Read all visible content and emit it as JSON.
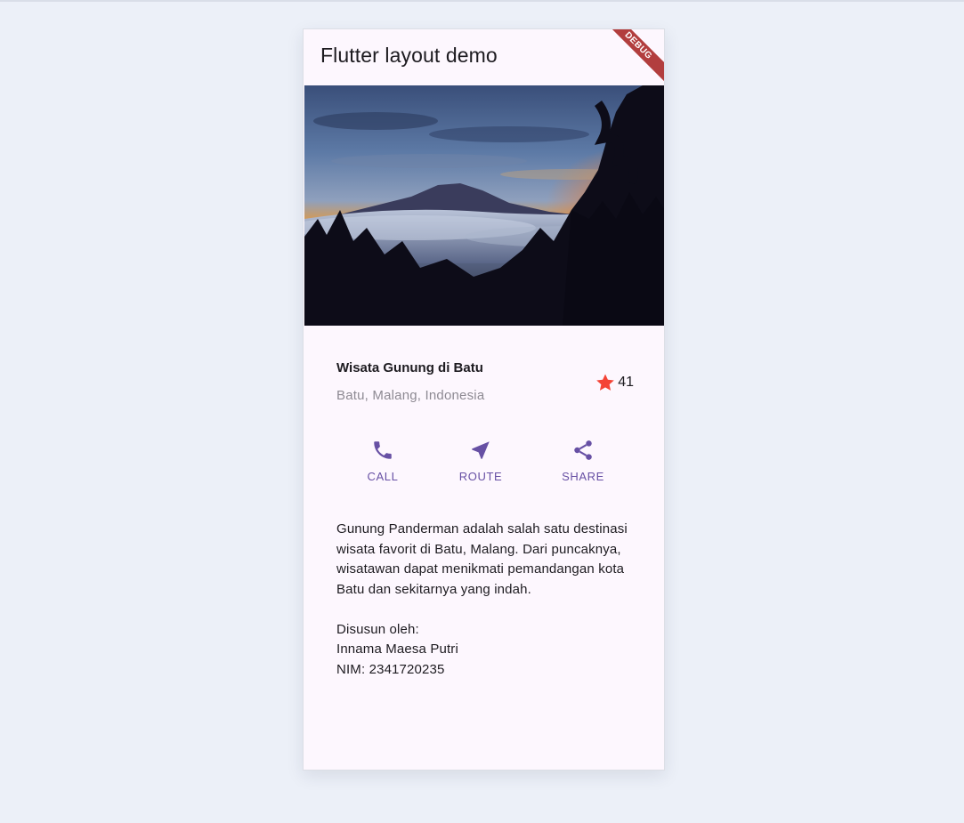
{
  "appbar": {
    "title": "Flutter layout demo",
    "debug_banner": "DEBUG"
  },
  "place": {
    "name": "Wisata Gunung di Batu",
    "location": "Batu, Malang, Indonesia",
    "rating_count": "41"
  },
  "actions": [
    {
      "label": "CALL",
      "icon": "phone-icon"
    },
    {
      "label": "ROUTE",
      "icon": "near-me-icon"
    },
    {
      "label": "SHARE",
      "icon": "share-icon"
    }
  ],
  "description": "Gunung Panderman adalah salah satu destinasi wisata favorit di Batu, Malang. Dari puncaknya, wisatawan dapat menikmati pemandangan kota Batu dan sekitarnya yang indah.\n\nDisusun oleh:\nInnama Maesa Putri\nNIM: 2341720235",
  "colors": {
    "accent": "#6750a4",
    "star": "#f44336",
    "background": "#ecf0f8",
    "surface": "#fdf7fe",
    "debug_banner": "#b23e3e"
  }
}
